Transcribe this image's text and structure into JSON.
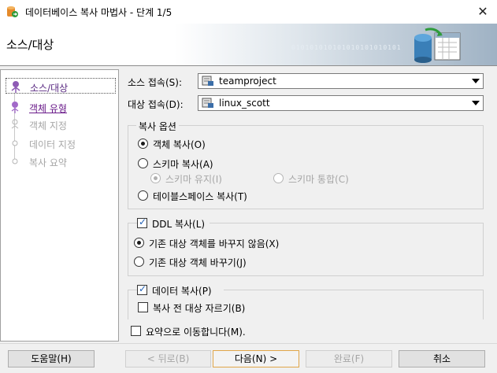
{
  "window": {
    "title": "데이터베이스 복사 마법사 - 단계 1/5",
    "close_glyph": "✕"
  },
  "header": {
    "step_title": "소스/대상",
    "binary_text": "010101010101010101010101"
  },
  "nav": {
    "items": [
      {
        "label": "소스/대상",
        "state": "current"
      },
      {
        "label": "객체 유형",
        "state": "next"
      },
      {
        "label": "객체 지정",
        "state": "disabled"
      },
      {
        "label": "데이터 지정",
        "state": "disabled"
      },
      {
        "label": "복사 요약",
        "state": "disabled"
      }
    ]
  },
  "connections": {
    "source_label": "소스 접속(S):",
    "source_value": "teamproject",
    "target_label": "대상 접속(D):",
    "target_value": "linux_scott"
  },
  "copy_options": {
    "title": "복사 옵션",
    "object_copy": "객체 복사(O)",
    "schema_copy": "스키마 복사(A)",
    "keep_schema": "스키마 유지(I)",
    "merge_schema": "스키마 통합(C)",
    "tablespace_copy": "테이블스페이스 복사(T)"
  },
  "ddl": {
    "title": "DDL 복사(L)",
    "no_replace": "기존 대상 객체를 바꾸지 않음(X)",
    "replace": "기존 대상 객체 바꾸기(J)"
  },
  "data": {
    "title": "데이터 복사(P)",
    "truncate": "복사 전 대상 자르기(B)"
  },
  "goto_summary": "요약으로 이동합니다(M).",
  "buttons": {
    "help": "도움말(H)",
    "back": "< 뒤로(B)",
    "next": "다음(N) >",
    "finish": "완료(F)",
    "cancel": "취소"
  }
}
